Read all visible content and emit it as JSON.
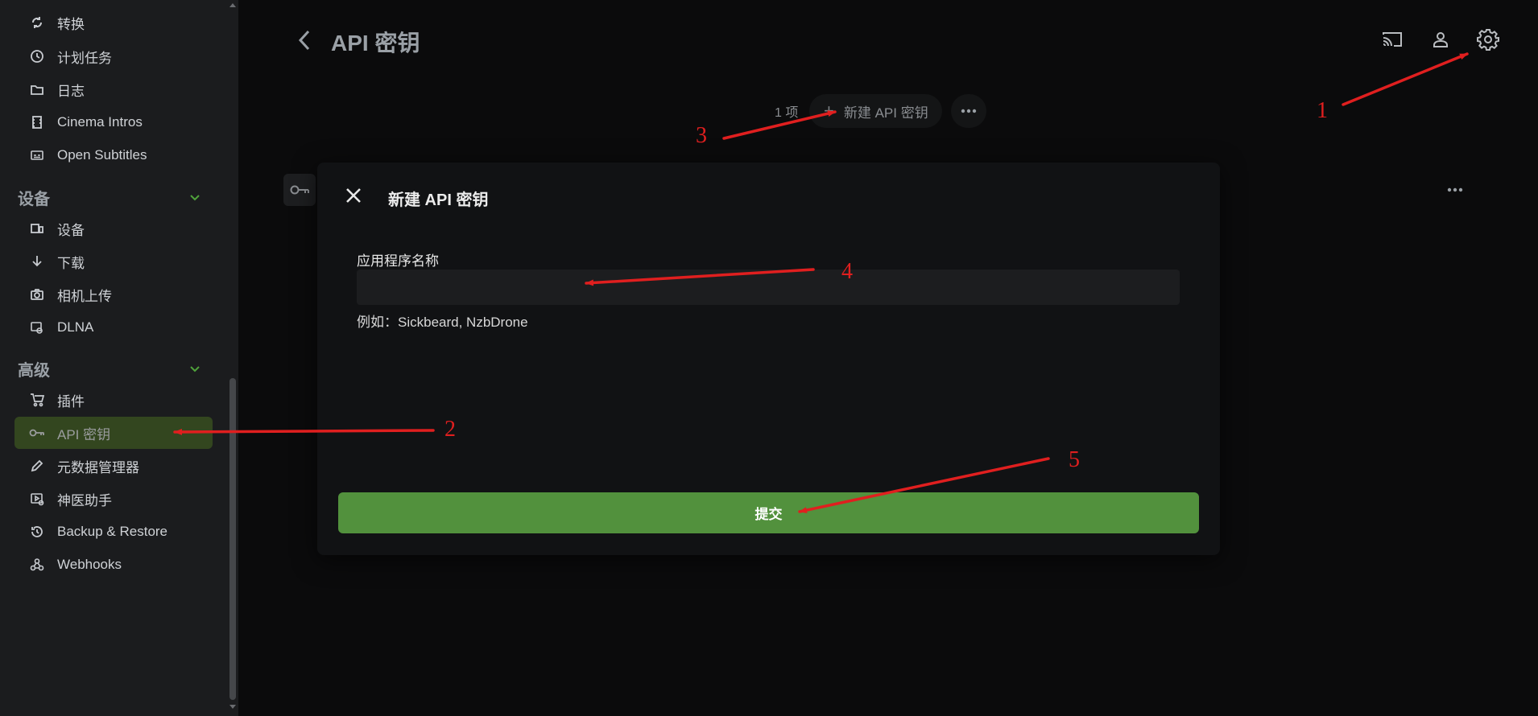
{
  "sidebar": {
    "items_top": [
      {
        "label": "转换",
        "icon": "convert-icon"
      },
      {
        "label": "计划任务",
        "icon": "clock-icon"
      },
      {
        "label": "日志",
        "icon": "folder-icon"
      },
      {
        "label": "Cinema Intros",
        "icon": "film-icon"
      },
      {
        "label": "Open Subtitles",
        "icon": "subtitles-icon"
      }
    ],
    "sections": [
      {
        "title": "设备",
        "items": [
          {
            "label": "设备",
            "icon": "devices-icon"
          },
          {
            "label": "下载",
            "icon": "download-icon"
          },
          {
            "label": "相机上传",
            "icon": "camera-icon"
          },
          {
            "label": "DLNA",
            "icon": "dlna-icon"
          }
        ]
      },
      {
        "title": "高级",
        "items": [
          {
            "label": "插件",
            "icon": "plugin-cart-icon"
          },
          {
            "label": "API 密钥",
            "icon": "key-icon",
            "active": true
          },
          {
            "label": "元数据管理器",
            "icon": "pencil-icon"
          },
          {
            "label": "神医助手",
            "icon": "helper-icon"
          },
          {
            "label": "Backup & Restore",
            "icon": "restore-icon"
          },
          {
            "label": "Webhooks",
            "icon": "webhook-icon"
          }
        ]
      }
    ]
  },
  "header": {
    "title": "API 密钥"
  },
  "toolbar": {
    "count": "1 项",
    "new_key_label": "新建 API 密钥"
  },
  "dialog": {
    "title": "新建 API 密钥",
    "field_label": "应用程序名称",
    "field_value": "",
    "hint": "例如：Sickbeard, NzbDrone",
    "submit_label": "提交"
  },
  "annotations": [
    "1",
    "2",
    "3",
    "4",
    "5"
  ],
  "colors": {
    "accent_green": "#52913d",
    "active_item_bg": "#33461f",
    "annotation_red": "#e01f1f"
  }
}
